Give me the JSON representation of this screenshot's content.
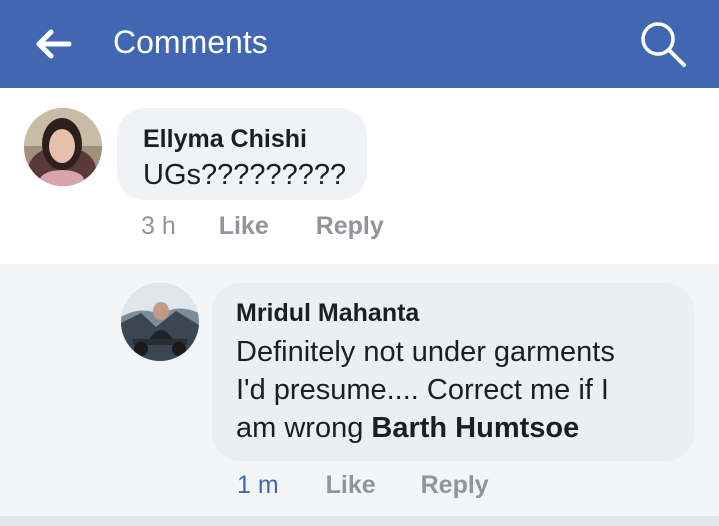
{
  "header": {
    "title": "Comments",
    "back_icon": "arrow-left-icon",
    "search_icon": "search-icon",
    "background": "#4267b2"
  },
  "comments": [
    {
      "author": "Ellyma Chishi",
      "text": "UGs?????????",
      "time": "3 h",
      "like_label": "Like",
      "reply_label": "Reply",
      "avatar_icon": "profile-photo-avatar"
    }
  ],
  "replies": [
    {
      "author": "Mridul Mahanta",
      "text_line1": "Definitely not under garments",
      "text_line2": "I'd presume.... Correct me if I",
      "text_line3": "am wrong",
      "mention": "Barth Humtsoe",
      "time": "1 m",
      "like_label": "Like",
      "reply_label": "Reply",
      "avatar_icon": "profile-photo-avatar"
    }
  ],
  "colors": {
    "accent": "#4267b2",
    "bubble": "#f0f2f5",
    "meta_text": "#90949c"
  }
}
